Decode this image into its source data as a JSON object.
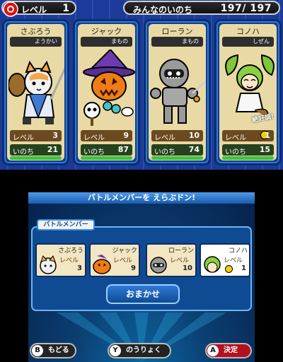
{
  "top": {
    "level_label": "レベル",
    "level_value": "1",
    "party_hp_label": "みんなのいのち",
    "party_hp_value": "197/ 197"
  },
  "cards": [
    {
      "name": "さぶろう",
      "tribe": "ようかい",
      "level_label": "レベル",
      "level": "3",
      "hp_label": "いのち",
      "hp": "21",
      "hp_fraction": 1.0,
      "icon": "cat-samurai-icon"
    },
    {
      "name": "ジャック",
      "tribe": "まもの",
      "level_label": "レベル",
      "level": "9",
      "hp_label": "いのち",
      "hp": "87",
      "hp_fraction": 1.0,
      "icon": "pumpkin-witch-icon"
    },
    {
      "name": "ローラン",
      "tribe": "まもの",
      "level_label": "レベル",
      "level": "10",
      "hp_label": "いのち",
      "hp": "74",
      "hp_fraction": 1.0,
      "icon": "knight-armor-icon"
    },
    {
      "name": "コノハ",
      "tribe": "しぜん",
      "level_label": "レベル",
      "level": "1",
      "hp_label": "いのち",
      "hp": "15",
      "hp_fraction": 1.0,
      "icon": "leaf-sprite-icon",
      "stamp": "絶好調!"
    }
  ],
  "bottom": {
    "banner": "バトルメンバーを えらぶドン!",
    "panel_title": "バトルメンバー",
    "members": [
      {
        "name": "さぶろう",
        "level_label": "レベル",
        "level": "3"
      },
      {
        "name": "ジャック",
        "level_label": "レベル",
        "level": "9"
      },
      {
        "name": "ローラン",
        "level_label": "レベル",
        "level": "10"
      },
      {
        "name": "コノハ",
        "level_label": "レベル",
        "level": "1"
      }
    ],
    "auto_button": "おまかせ",
    "footer": {
      "back_key": "B",
      "back_label": "もどる",
      "ability_key": "Y",
      "ability_label": "のうりょく",
      "confirm_key": "A",
      "confirm_label": "決定"
    }
  },
  "colors": {
    "frame_blue": "#1e3f9e",
    "card_bg": "#e9d9a5",
    "hp_green": "#3fc33f",
    "confirm_red": "#b4111f"
  }
}
